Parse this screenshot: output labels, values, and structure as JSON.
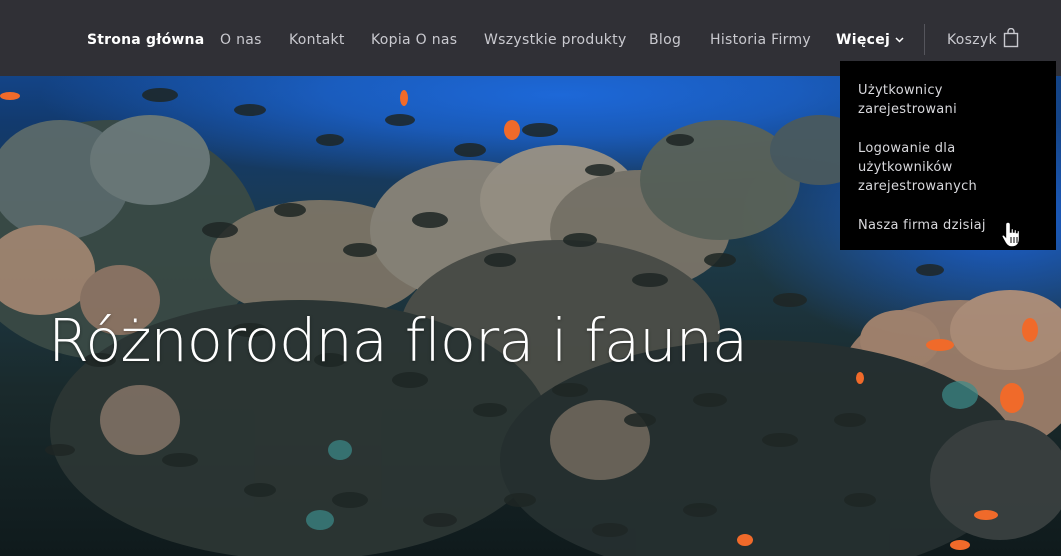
{
  "nav": {
    "items": [
      {
        "label": "Strona główna",
        "state": "active"
      },
      {
        "label": "O nas"
      },
      {
        "label": "Kontakt"
      },
      {
        "label": "Kopia O nas"
      },
      {
        "label": "Wszystkie produkty"
      },
      {
        "label": "Blog"
      },
      {
        "label": "Historia Firmy"
      },
      {
        "label": "Więcej",
        "state": "open"
      }
    ],
    "cart_label": "Koszyk"
  },
  "dropdown": {
    "items": [
      {
        "label": "Użytkownicy zarejestrowani"
      },
      {
        "label": "Logowanie dla użytkowników zarejestrowanych"
      },
      {
        "label": "Nasza firma dzisiaj"
      }
    ]
  },
  "hero": {
    "title": "Różnorodna flora i fauna"
  },
  "colors": {
    "navbar_bg": "#303036",
    "dropdown_bg": "#000000",
    "nav_text": "#c9c9cf",
    "nav_active": "#ffffff"
  }
}
